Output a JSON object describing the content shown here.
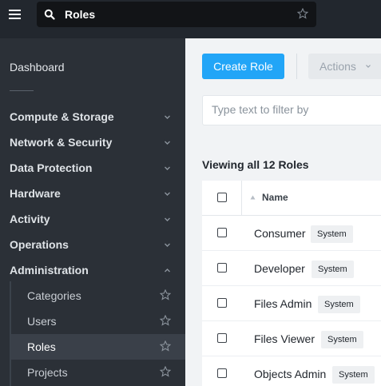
{
  "topbar": {
    "search_value": "Roles"
  },
  "sidebar": {
    "dashboard": "Dashboard",
    "groups": [
      {
        "label": "Compute & Storage",
        "expanded": false
      },
      {
        "label": "Network & Security",
        "expanded": false
      },
      {
        "label": "Data Protection",
        "expanded": false
      },
      {
        "label": "Hardware",
        "expanded": false
      },
      {
        "label": "Activity",
        "expanded": false
      },
      {
        "label": "Operations",
        "expanded": false
      },
      {
        "label": "Administration",
        "expanded": true
      }
    ],
    "subitems": [
      {
        "label": "Categories",
        "active": false
      },
      {
        "label": "Users",
        "active": false
      },
      {
        "label": "Roles",
        "active": true
      },
      {
        "label": "Projects",
        "active": false
      }
    ]
  },
  "toolbar": {
    "create_label": "Create Role",
    "actions_label": "Actions"
  },
  "filter": {
    "placeholder": "Type text to filter by"
  },
  "summary": "Viewing all 12 Roles",
  "table": {
    "column_name": "Name",
    "rows": [
      {
        "name": "Consumer",
        "badge": "System"
      },
      {
        "name": "Developer",
        "badge": "System"
      },
      {
        "name": "Files Admin",
        "badge": "System"
      },
      {
        "name": "Files Viewer",
        "badge": "System"
      },
      {
        "name": "Objects Admin",
        "badge": "System"
      }
    ]
  },
  "colors": {
    "accent": "#22a5f7",
    "topbar": "#22272e",
    "sidebar": "#2b3037",
    "sidebar_active": "#3a4049"
  },
  "icons": [
    "hamburger-menu-icon",
    "search-icon",
    "star-icon",
    "chevron-down-icon",
    "chevron-up-icon",
    "sort-ascending-icon"
  ]
}
